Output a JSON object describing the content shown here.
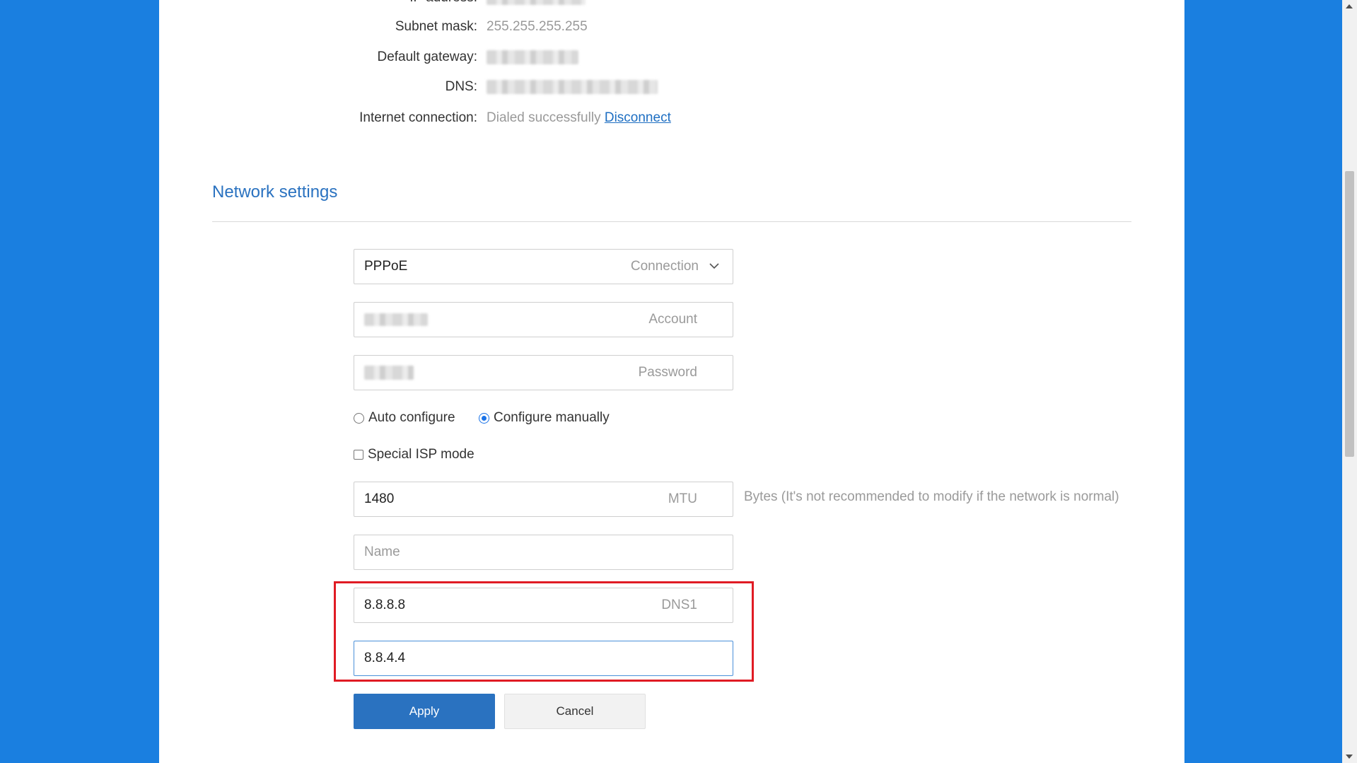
{
  "status": {
    "ip_label": "IP address:",
    "subnet_label": "Subnet mask:",
    "subnet_value": "255.255.255.255",
    "gateway_label": "Default gateway:",
    "dns_label": "DNS:",
    "internet_label": "Internet connection:",
    "internet_value": "Dialed successfully",
    "disconnect_label": "Disconnect"
  },
  "network": {
    "title": "Network settings",
    "connection_value": "PPPoE",
    "connection_label": "Connection",
    "account_label": "Account",
    "password_label": "Password",
    "auto_configure_label": "Auto configure",
    "configure_manually_label": "Configure manually",
    "selected_mode": "Configure manually",
    "special_isp_label": "Special ISP mode",
    "mtu_value": "1480",
    "mtu_label": "MTU",
    "mtu_hint": "Bytes (It's not recommended to modify if the network is normal)",
    "name_placeholder": "Name",
    "dns1_value": "8.8.8.8",
    "dns1_label": "DNS1",
    "dns2_value": "8.8.4.4"
  },
  "buttons": {
    "apply_label": "Apply",
    "cancel_label": "Cancel"
  },
  "colors": {
    "background": "#1a7fe0",
    "accent": "#2a72c0",
    "highlight": "#e01b24"
  }
}
